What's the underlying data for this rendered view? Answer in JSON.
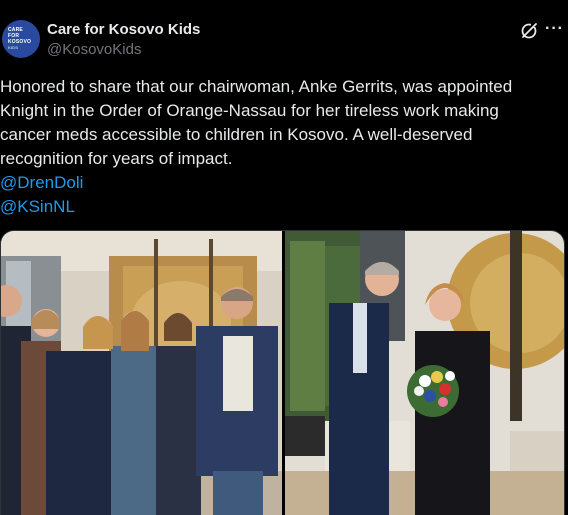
{
  "author": {
    "display_name": "Care for Kosovo Kids",
    "handle": "@KosovoKids",
    "avatar_lines": [
      "CARE",
      "FOR",
      "KOSOVO",
      "KIDS"
    ]
  },
  "header_icons": {
    "grok": "grok-icon",
    "more": "···"
  },
  "tweet": {
    "text": "Honored to share that our chairwoman, Anke Gerrits, was appointed\nKnight in the Order of Orange-Nassau for her tireless work making\ncancer meds accessible to children in Kosovo. A well-deserved\nrecognition for years of impact.",
    "mentions": [
      "@DrenDoli",
      "@KSinNL"
    ]
  },
  "colors": {
    "background": "#000000",
    "text": "#e7e9ea",
    "secondary": "#71767b",
    "link": "#1d9bf0",
    "avatar": "#2a4aa0"
  },
  "media": {
    "count": 2,
    "photos": [
      "group-photo",
      "bouquet-photo"
    ]
  }
}
